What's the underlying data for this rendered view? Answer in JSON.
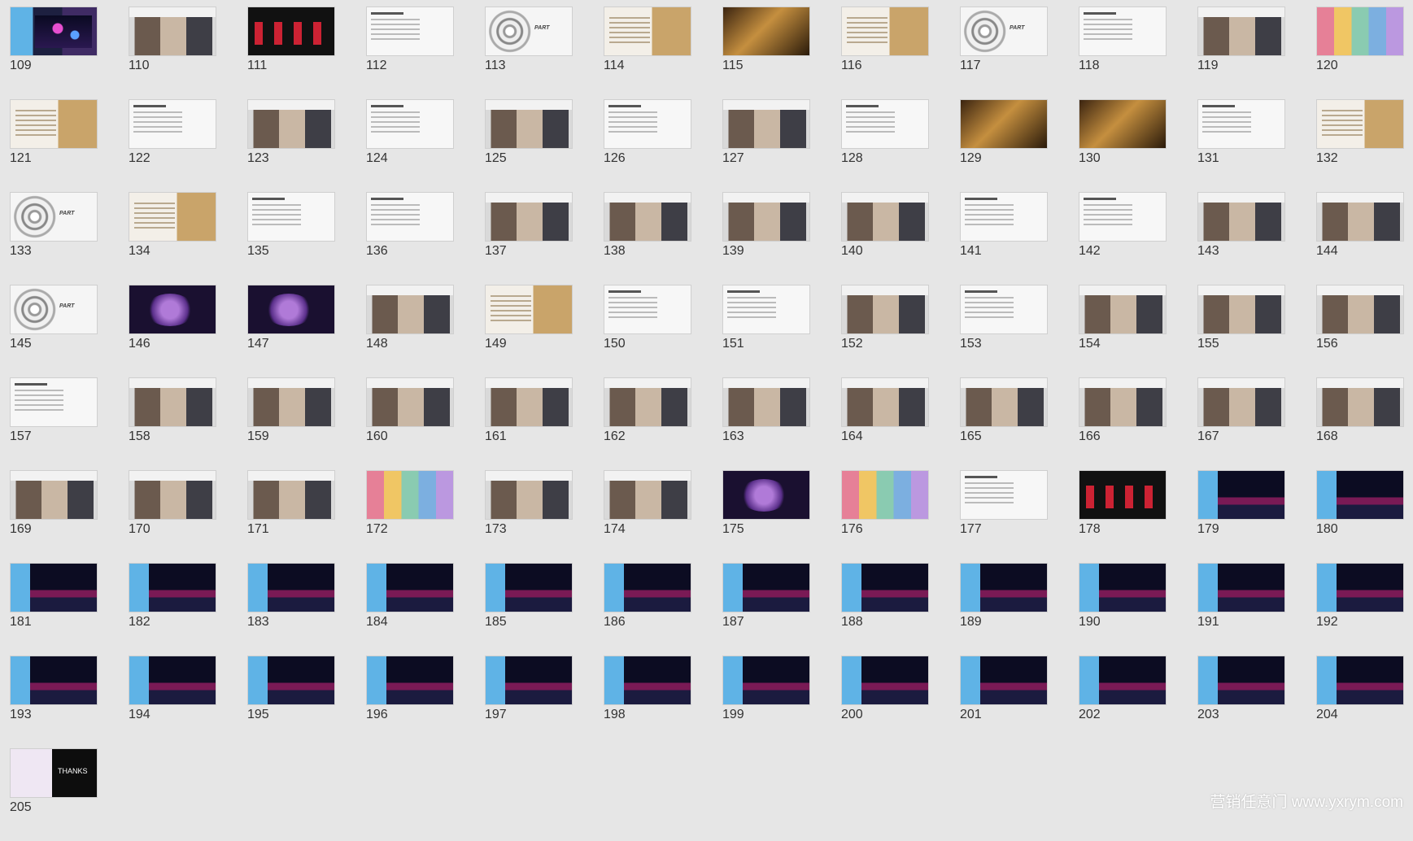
{
  "slides": [
    {
      "n": "109",
      "style": "blue"
    },
    {
      "n": "110",
      "style": "photo"
    },
    {
      "n": "111",
      "style": "dark"
    },
    {
      "n": "112",
      "style": "white"
    },
    {
      "n": "113",
      "style": "spiral"
    },
    {
      "n": "114",
      "style": "gold"
    },
    {
      "n": "115",
      "style": "hall"
    },
    {
      "n": "116",
      "style": "gold"
    },
    {
      "n": "117",
      "style": "spiral"
    },
    {
      "n": "118",
      "style": "white"
    },
    {
      "n": "119",
      "style": "photo"
    },
    {
      "n": "120",
      "style": "colorful"
    },
    {
      "n": "121",
      "style": "gold"
    },
    {
      "n": "122",
      "style": "white"
    },
    {
      "n": "123",
      "style": "photo"
    },
    {
      "n": "124",
      "style": "white"
    },
    {
      "n": "125",
      "style": "photo"
    },
    {
      "n": "126",
      "style": "white"
    },
    {
      "n": "127",
      "style": "photo"
    },
    {
      "n": "128",
      "style": "white"
    },
    {
      "n": "129",
      "style": "hall"
    },
    {
      "n": "130",
      "style": "hall"
    },
    {
      "n": "131",
      "style": "white"
    },
    {
      "n": "132",
      "style": "gold"
    },
    {
      "n": "133",
      "style": "spiral"
    },
    {
      "n": "134",
      "style": "gold"
    },
    {
      "n": "135",
      "style": "white"
    },
    {
      "n": "136",
      "style": "white"
    },
    {
      "n": "137",
      "style": "photo"
    },
    {
      "n": "138",
      "style": "photo"
    },
    {
      "n": "139",
      "style": "photo"
    },
    {
      "n": "140",
      "style": "photo"
    },
    {
      "n": "141",
      "style": "white"
    },
    {
      "n": "142",
      "style": "white"
    },
    {
      "n": "143",
      "style": "photo"
    },
    {
      "n": "144",
      "style": "photo"
    },
    {
      "n": "145",
      "style": "spiral"
    },
    {
      "n": "146",
      "style": "purple"
    },
    {
      "n": "147",
      "style": "purple"
    },
    {
      "n": "148",
      "style": "photo"
    },
    {
      "n": "149",
      "style": "gold"
    },
    {
      "n": "150",
      "style": "white"
    },
    {
      "n": "151",
      "style": "white"
    },
    {
      "n": "152",
      "style": "photo"
    },
    {
      "n": "153",
      "style": "white"
    },
    {
      "n": "154",
      "style": "photo"
    },
    {
      "n": "155",
      "style": "photo"
    },
    {
      "n": "156",
      "style": "photo"
    },
    {
      "n": "157",
      "style": "white"
    },
    {
      "n": "158",
      "style": "photo"
    },
    {
      "n": "159",
      "style": "photo"
    },
    {
      "n": "160",
      "style": "photo"
    },
    {
      "n": "161",
      "style": "photo"
    },
    {
      "n": "162",
      "style": "photo"
    },
    {
      "n": "163",
      "style": "photo"
    },
    {
      "n": "164",
      "style": "photo"
    },
    {
      "n": "165",
      "style": "photo"
    },
    {
      "n": "166",
      "style": "photo"
    },
    {
      "n": "167",
      "style": "photo"
    },
    {
      "n": "168",
      "style": "photo"
    },
    {
      "n": "169",
      "style": "photo"
    },
    {
      "n": "170",
      "style": "photo"
    },
    {
      "n": "171",
      "style": "photo"
    },
    {
      "n": "172",
      "style": "colorful"
    },
    {
      "n": "173",
      "style": "photo"
    },
    {
      "n": "174",
      "style": "photo"
    },
    {
      "n": "175",
      "style": "purple"
    },
    {
      "n": "176",
      "style": "colorful"
    },
    {
      "n": "177",
      "style": "white"
    },
    {
      "n": "178",
      "style": "dark"
    },
    {
      "n": "179",
      "style": "stage"
    },
    {
      "n": "180",
      "style": "stage"
    },
    {
      "n": "181",
      "style": "stage"
    },
    {
      "n": "182",
      "style": "stage"
    },
    {
      "n": "183",
      "style": "stage"
    },
    {
      "n": "184",
      "style": "stage"
    },
    {
      "n": "185",
      "style": "stage"
    },
    {
      "n": "186",
      "style": "stage"
    },
    {
      "n": "187",
      "style": "stage"
    },
    {
      "n": "188",
      "style": "stage"
    },
    {
      "n": "189",
      "style": "stage"
    },
    {
      "n": "190",
      "style": "stage"
    },
    {
      "n": "191",
      "style": "stage"
    },
    {
      "n": "192",
      "style": "stage"
    },
    {
      "n": "193",
      "style": "stage"
    },
    {
      "n": "194",
      "style": "stage"
    },
    {
      "n": "195",
      "style": "stage"
    },
    {
      "n": "196",
      "style": "stage"
    },
    {
      "n": "197",
      "style": "stage"
    },
    {
      "n": "198",
      "style": "stage"
    },
    {
      "n": "199",
      "style": "stage"
    },
    {
      "n": "200",
      "style": "stage"
    },
    {
      "n": "201",
      "style": "stage"
    },
    {
      "n": "202",
      "style": "stage"
    },
    {
      "n": "203",
      "style": "stage"
    },
    {
      "n": "204",
      "style": "stage"
    },
    {
      "n": "205",
      "style": "thanks"
    }
  ],
  "watermark": "营销任意门 www.yxrym.com"
}
